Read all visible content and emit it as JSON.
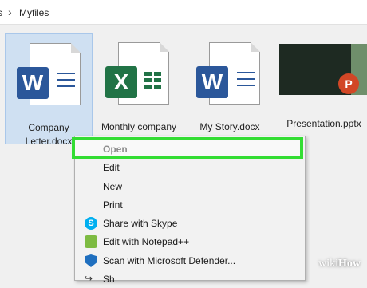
{
  "breadcrumb": {
    "previous_fragment": "s",
    "separator": "›",
    "current": "Myfiles"
  },
  "files": [
    {
      "label": "Company Letter.docx",
      "type": "word",
      "icon_letter": "W",
      "selected": true
    },
    {
      "label": "Monthly company",
      "type": "excel",
      "icon_letter": "X",
      "selected": false
    },
    {
      "label": "My Story.docx",
      "type": "word",
      "icon_letter": "W",
      "selected": false
    },
    {
      "label": "Presentation.pptx",
      "type": "powerpoint",
      "icon_letter": "P",
      "selected": false
    }
  ],
  "context_menu": {
    "items": [
      {
        "label": "Open",
        "icon": null
      },
      {
        "label": "Edit",
        "icon": null
      },
      {
        "label": "New",
        "icon": null
      },
      {
        "label": "Print",
        "icon": null
      },
      {
        "label": "Share with Skype",
        "icon": "skype-icon"
      },
      {
        "label": "Edit with Notepad++",
        "icon": "notepad-plus-plus-icon"
      },
      {
        "label": "Scan with Microsoft Defender...",
        "icon": "microsoft-defender-icon"
      },
      {
        "label": "Sh",
        "icon": "share-icon"
      }
    ]
  },
  "watermark": {
    "prefix": "wiki",
    "suffix": "How"
  },
  "colors": {
    "word": "#2b579a",
    "excel": "#217346",
    "powerpoint": "#d24726",
    "highlight": "#33dd33",
    "selection": "#cfe0f2"
  }
}
